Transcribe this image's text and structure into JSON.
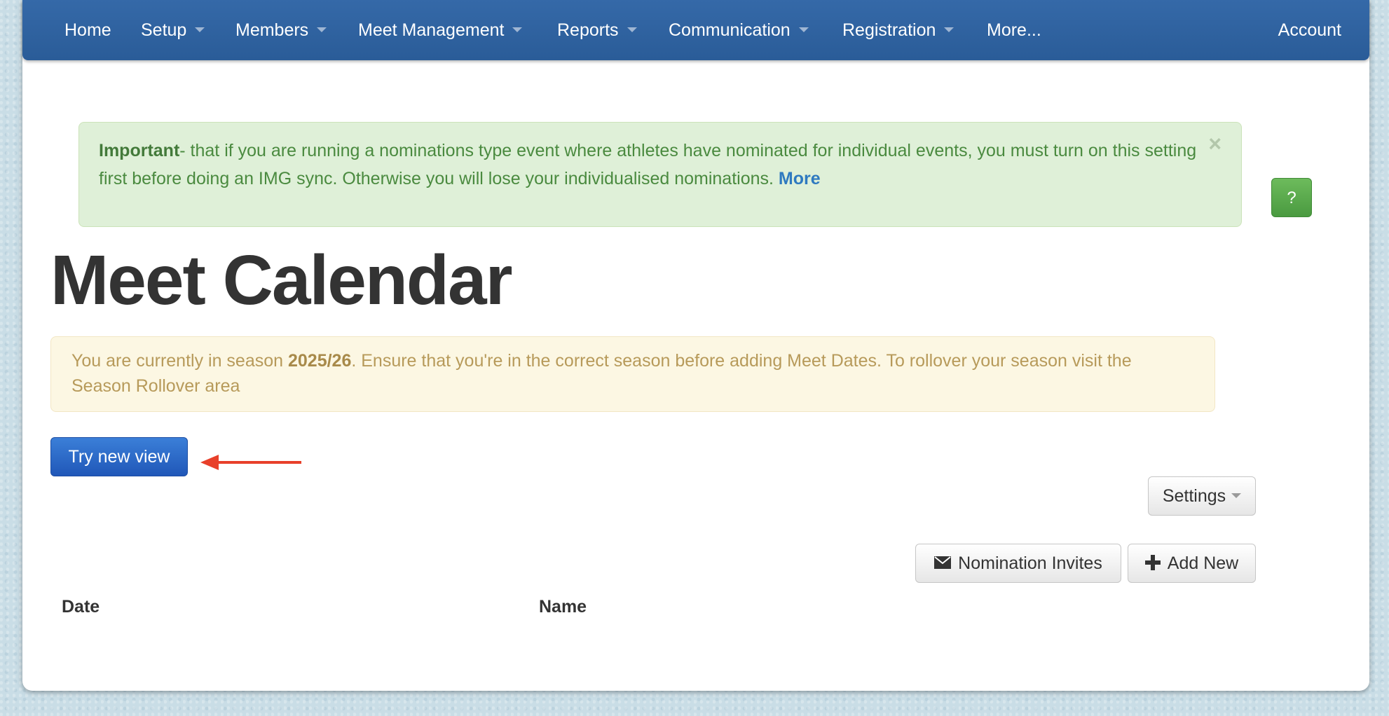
{
  "navbar": {
    "items": [
      {
        "label": "Home",
        "has_dropdown": false
      },
      {
        "label": "Setup",
        "has_dropdown": true
      },
      {
        "label": "Members",
        "has_dropdown": true
      },
      {
        "label": "Meet Management",
        "has_dropdown": true
      },
      {
        "label": "Reports",
        "has_dropdown": true
      },
      {
        "label": "Communication",
        "has_dropdown": true
      },
      {
        "label": "Registration",
        "has_dropdown": true
      },
      {
        "label": "More...",
        "has_dropdown": false
      }
    ],
    "account_label": "Account",
    "color": "#2d5f9c"
  },
  "notice": {
    "strong": "Important",
    "text": "- that if you are running a nominations type event where athletes have nominated for individual events, you must turn on this setting first before doing an IMG sync. Otherwise you will lose your individualised nominations.",
    "link": "More",
    "close_icon": "×"
  },
  "help_button": {
    "label": "?"
  },
  "page_title": "Meet Calendar",
  "season_alert": {
    "prefix": "You are currently in season ",
    "season": "2025/26",
    "suffix": ". Ensure that you're in the correct season before adding Meet Dates. To rollover your season visit the Season Rollover area"
  },
  "try_new_view_button": "Try new view",
  "settings_button": "Settings",
  "actions": {
    "nomination_invites": "Nomination Invites",
    "add_new": "Add New"
  },
  "table": {
    "columns": [
      "Date",
      "Name"
    ]
  },
  "colors": {
    "primary": "#2a63c4",
    "success_bg": "#dff0d8",
    "warning_bg": "#fcf7e3",
    "annotation_arrow": "#e8402a"
  }
}
